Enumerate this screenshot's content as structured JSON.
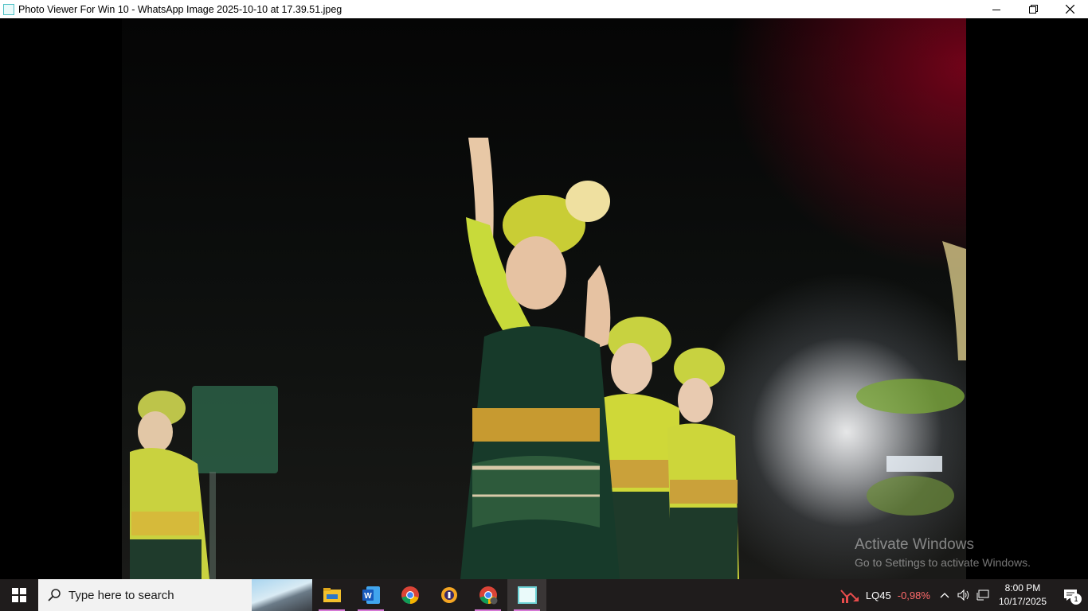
{
  "window": {
    "title": "Photo Viewer For Win 10 - WhatsApp Image 2025-10-10 at 17.39.51.jpeg"
  },
  "watermark": {
    "line1": "Activate Windows",
    "line2": "Go to Settings to activate Windows."
  },
  "taskbar": {
    "search_placeholder": "Type here to search",
    "pinned": [
      {
        "name": "file-explorer",
        "running": true
      },
      {
        "name": "word",
        "running": true
      },
      {
        "name": "chrome",
        "running": false
      },
      {
        "name": "vpn",
        "running": false
      },
      {
        "name": "chrome-profile",
        "running": true
      },
      {
        "name": "photo-viewer",
        "running": true,
        "active": true
      }
    ],
    "stock": {
      "symbol": "LQ45",
      "change": "-0,98%",
      "color": "#ff6b6b"
    },
    "clock": {
      "time": "8:00 PM",
      "date": "10/17/2025"
    },
    "notifications": "1"
  },
  "colors": {
    "accent": "#d57ad5",
    "taskbar": "#1f1c1c"
  }
}
